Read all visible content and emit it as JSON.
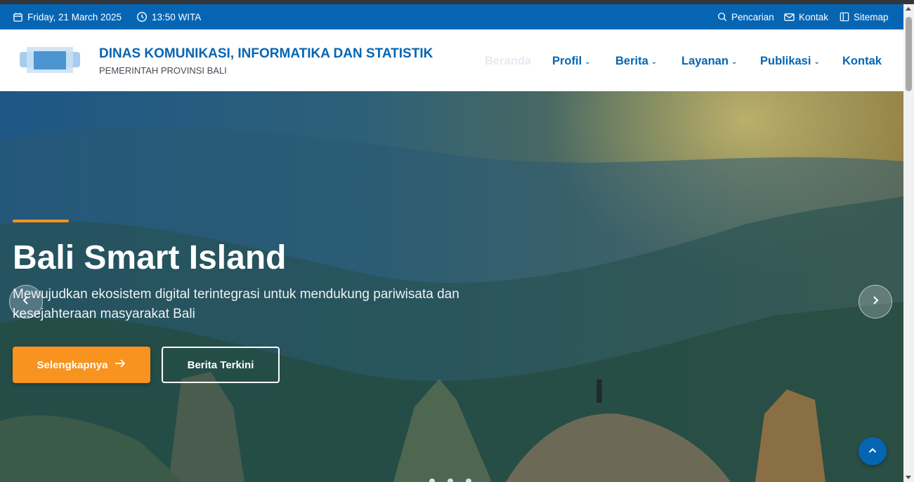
{
  "topbar": {
    "date": "Friday, 21 March 2025",
    "time": "13:50 WITA",
    "links": {
      "search": "Pencarian",
      "contact": "Kontak",
      "sitemap": "Sitemap"
    }
  },
  "header": {
    "title": "DINAS KOMUNIKASI, INFORMATIKA DAN STATISTIK",
    "subtitle": "PEMERINTAH PROVINSI BALI"
  },
  "nav": {
    "home": "Beranda",
    "profile": "Profil",
    "news": "Berita",
    "services": "Layanan",
    "publications": "Publikasi",
    "contact": "Kontak"
  },
  "hero": {
    "title": "Bali Smart Island",
    "text": "Mewujudkan ekosistem digital terintegrasi untuk mendukung pariwisata dan kesejahteraan masyarakat Bali",
    "primary_button": "Selengkapnya",
    "secondary_button": "Berita Terkini"
  },
  "colors": {
    "brand_blue": "#0565b3",
    "accent_orange": "#f7931e"
  },
  "icons": [
    "calendar-icon",
    "clock-icon",
    "search-icon",
    "mail-icon",
    "sitemap-icon",
    "chevron-down-icon",
    "arrow-right-icon",
    "chevron-left-icon",
    "chevron-right-icon",
    "arrow-up-icon"
  ]
}
